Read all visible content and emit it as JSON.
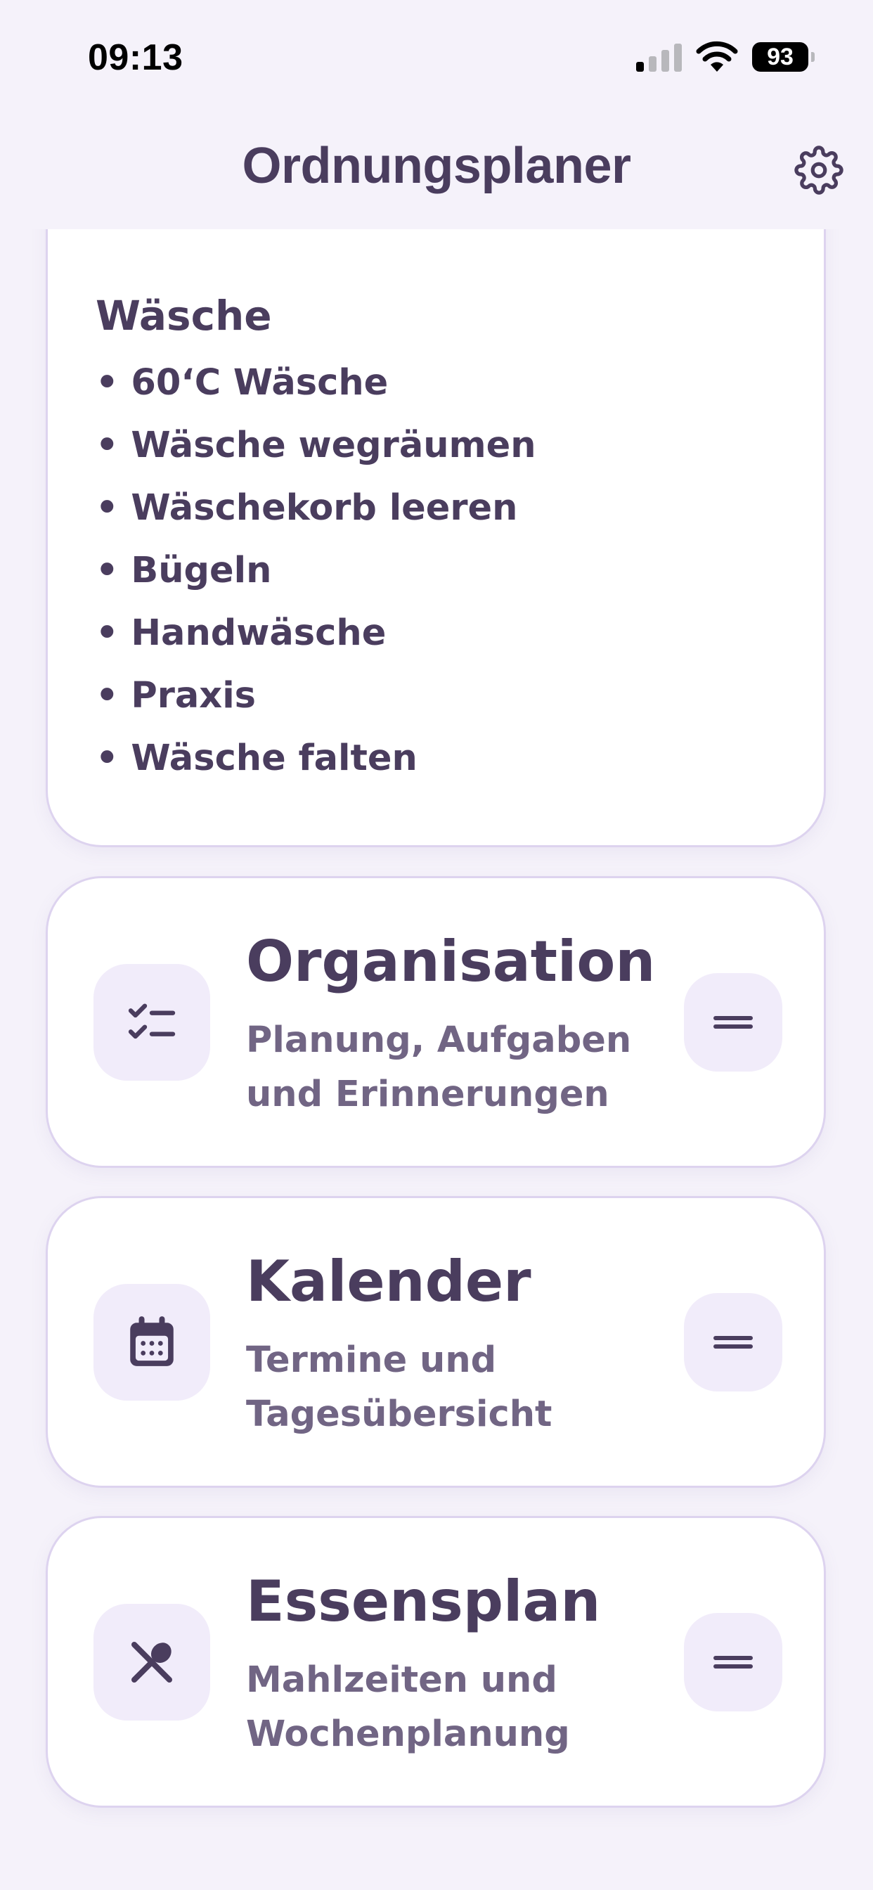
{
  "status_bar": {
    "time": "09:13",
    "battery": "93"
  },
  "header": {
    "title": "Ordnungsplaner",
    "settings_icon": "gear-icon"
  },
  "laundry": {
    "title": "Wäsche",
    "items": [
      "60‘C Wäsche",
      "Wäsche wegräumen",
      "Wäschekorb leeren",
      "Bügeln",
      "Handwäsche",
      "Praxis",
      "Wäsche falten"
    ]
  },
  "features": [
    {
      "title": "Organisation",
      "subtitle": "Planung, Aufgaben und Erinnerungen",
      "icon": "checklist-icon"
    },
    {
      "title": "Kalender",
      "subtitle": "Termine und Tagesübersicht",
      "icon": "calendar-icon"
    },
    {
      "title": "Essensplan",
      "subtitle": "Mahlzeiten und Wochenplanung",
      "icon": "fork-spoon-icon"
    }
  ],
  "colors": {
    "background": "#f5f2fa",
    "text": "#4a3d5e",
    "subtext": "#716584",
    "accent_bg": "#f1ecfa",
    "border": "#ddd3ef"
  }
}
